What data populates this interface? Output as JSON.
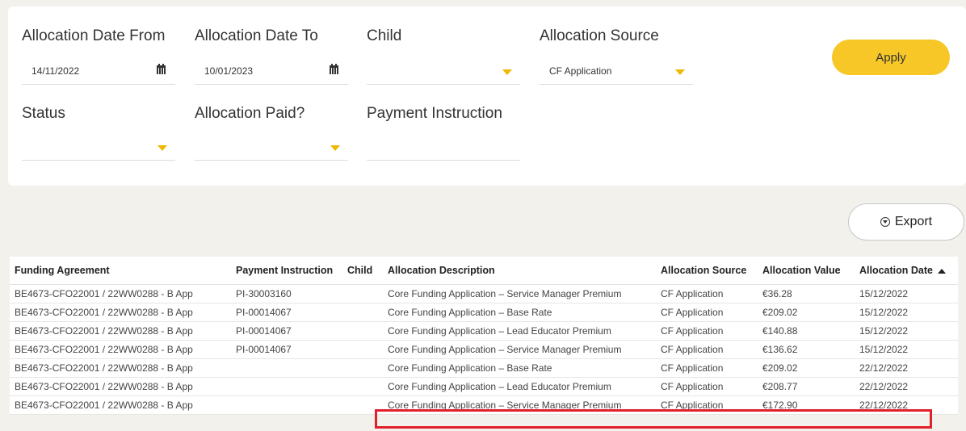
{
  "filters": {
    "allocation_date_from": {
      "label": "Allocation Date From",
      "value": "14/11/2022",
      "icon": "calendar-icon"
    },
    "allocation_date_to": {
      "label": "Allocation Date To",
      "value": "10/01/2023",
      "icon": "calendar-icon"
    },
    "child": {
      "label": "Child",
      "value": ""
    },
    "allocation_source": {
      "label": "Allocation Source",
      "value": "CF Application"
    },
    "status": {
      "label": "Status",
      "value": ""
    },
    "allocation_paid": {
      "label": "Allocation Paid?",
      "value": ""
    },
    "payment_instruction": {
      "label": "Payment Instruction",
      "value": ""
    },
    "apply_label": "Apply"
  },
  "export": {
    "label": "Export",
    "icon": "download-circle-icon"
  },
  "table": {
    "headers": [
      "Funding Agreement",
      "Payment Instruction",
      "Child",
      "Allocation Description",
      "Allocation Source",
      "Allocation Value",
      "Allocation Date"
    ],
    "sorted_column": "Allocation Date",
    "sort_direction": "ascending",
    "rows": [
      [
        "BE4673-CFO22001 / 22WW0288 - B App",
        "PI-30003160",
        "",
        "Core Funding Application – Service Manager Premium",
        "CF Application",
        "€36.28",
        "15/12/2022"
      ],
      [
        "BE4673-CFO22001 / 22WW0288 - B App",
        "PI-00014067",
        "",
        "Core Funding Application – Base Rate",
        "CF Application",
        "€209.02",
        "15/12/2022"
      ],
      [
        "BE4673-CFO22001 / 22WW0288 - B App",
        "PI-00014067",
        "",
        "Core Funding Application – Lead Educator Premium",
        "CF Application",
        "€140.88",
        "15/12/2022"
      ],
      [
        "BE4673-CFO22001 / 22WW0288 - B App",
        "PI-00014067",
        "",
        "Core Funding Application – Service Manager Premium",
        "CF Application",
        "€136.62",
        "15/12/2022"
      ],
      [
        "BE4673-CFO22001 / 22WW0288 - B App",
        "",
        "",
        "Core Funding Application – Base Rate",
        "CF Application",
        "€209.02",
        "22/12/2022"
      ],
      [
        "BE4673-CFO22001 / 22WW0288 - B App",
        "",
        "",
        "Core Funding Application – Lead Educator Premium",
        "CF Application",
        "€208.77",
        "22/12/2022"
      ],
      [
        "BE4673-CFO22001 / 22WW0288 - B App",
        "",
        "",
        "Core Funding Application – Service Manager Premium",
        "CF Application",
        "€172.90",
        "22/12/2022"
      ]
    ]
  },
  "colors": {
    "accent": "#f6c727",
    "caret": "#f0b800",
    "highlight": "#e0202a",
    "background": "#f2f1ec"
  }
}
